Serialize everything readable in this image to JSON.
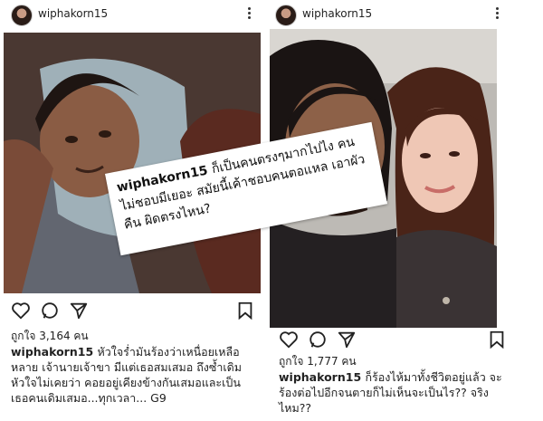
{
  "left_post": {
    "username": "wiphakorn15",
    "likes": "ถูกใจ 3,164 คน",
    "caption_user": "wiphakorn15",
    "caption_text": "หัวใจร่ำมันร้องว่าเหนื่อยเหลือหลาย เจ้านายเจ้าขา มีแต่เธอสมเสมอ ถึงซ้ำเดิม หัวใจไม่เคยว่า คอยอยู่เคียงข้างกันเสมอและเป็นเธอคนเดิมเสมอ...ทุกเวลา... G9"
  },
  "right_post": {
    "username": "wiphakorn15",
    "likes": "ถูกใจ 1,777 คน",
    "caption_user": "wiphakorn15",
    "caption_text": "ก็ร้องไห้มาทั้งชีวิตอยู่แล้ว จะร้องต่อไปอีกจนตายก็ไม่เห็นจะเป็นไร?? จริงไหม??"
  },
  "overlay": {
    "user": "wiphakorn15",
    "text": "ก็เป็นคนตรงๆมากไปไง คนไม่ชอบมีเยอะ สมัยนี้เค้าชอบคนตอแหล เอาผัวคืน ผิดตรงไหน?"
  }
}
